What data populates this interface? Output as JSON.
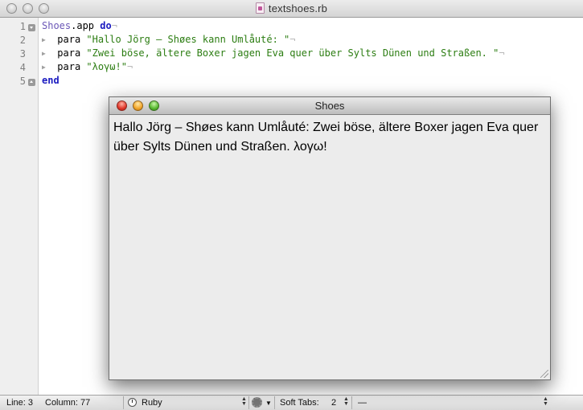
{
  "window": {
    "title": "textshoes.rb"
  },
  "editor": {
    "line_numbers": [
      "1",
      "2",
      "3",
      "4",
      "5"
    ],
    "lines": [
      {
        "const": "Shoes",
        "plain": ".app ",
        "kw": "do",
        "invisible": "¬"
      },
      {
        "plain": "para ",
        "str": "\"Hallo Jörg – Shøes kann Umlåuté: \"",
        "invisible": "¬"
      },
      {
        "plain": "para ",
        "str": "\"Zwei böse, ältere Boxer jagen Eva quer über Sylts Dünen und Straßen. \"",
        "invisible": "¬"
      },
      {
        "plain": "para ",
        "str": "\"λογω!\"",
        "invisible": "¬"
      },
      {
        "kw": "end"
      }
    ]
  },
  "statusbar": {
    "line": "Line: 3",
    "column": "Column: 77",
    "language": "Ruby",
    "soft_tabs_label": "Soft Tabs:",
    "soft_tabs_value": "2",
    "symbol": "—"
  },
  "shoes_window": {
    "title": "Shoes",
    "paragraph_1": "Hallo Jörg – Shøes kann Umlåuté:  Zwei böse, ältere Boxer jagen Eva quer",
    "paragraph_2": "über Sylts Dünen und Straßen.  λογω!"
  }
}
